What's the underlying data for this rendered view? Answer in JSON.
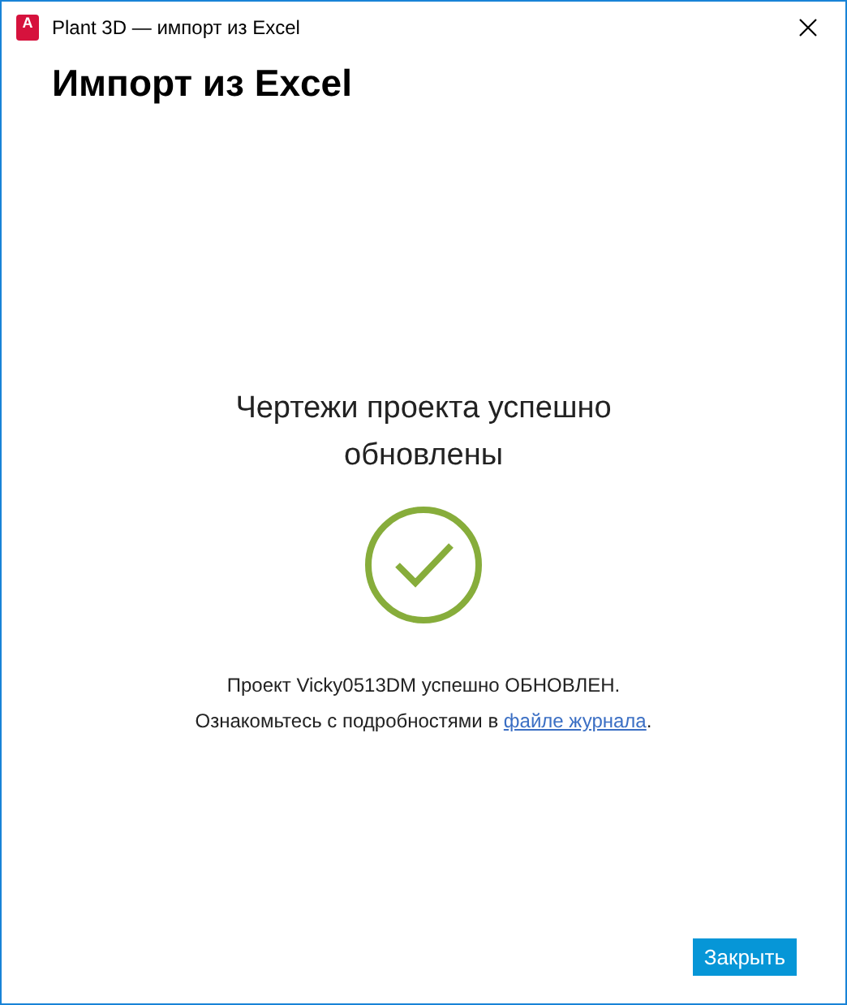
{
  "window": {
    "title": "Plant 3D — импорт из Excel",
    "app_icon_letter": "A"
  },
  "heading": "Импорт из Excel",
  "result": {
    "title": "Чертежи проекта успешно обновлены",
    "succeeded": true,
    "message": "Проект Vicky0513DM успешно ОБНОВЛЕН.",
    "details_before": "Ознакомьтесь с подробностями в ",
    "details_link": "файле журнала",
    "details_after": "."
  },
  "buttons": [
    "Закрыть"
  ]
}
